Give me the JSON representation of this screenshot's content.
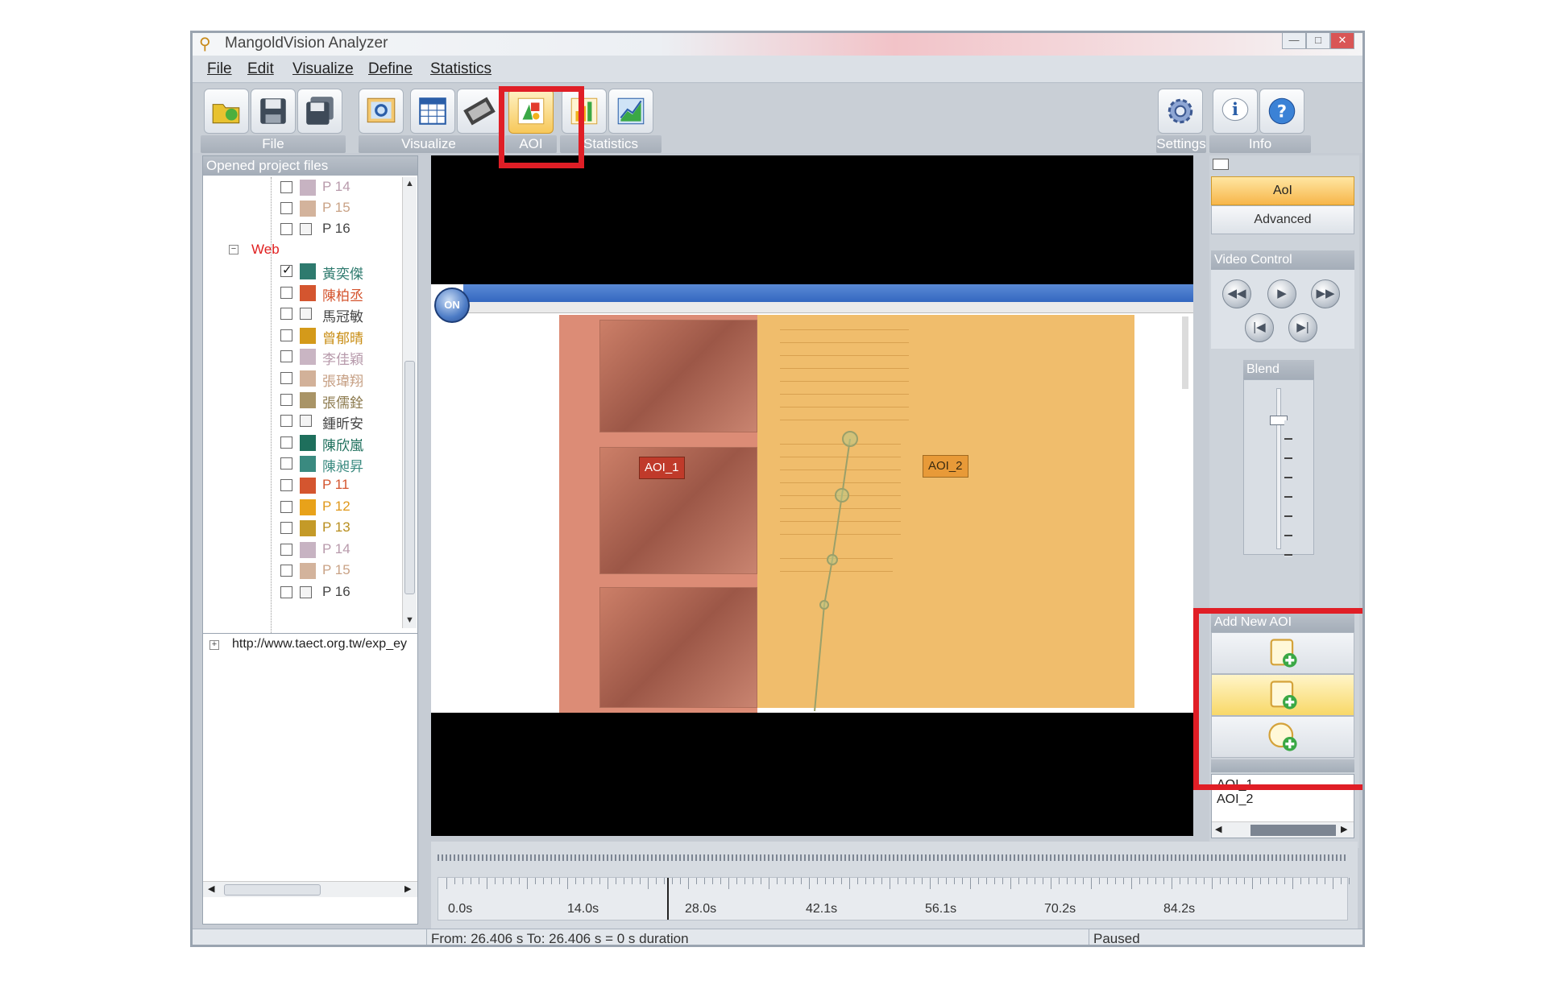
{
  "window": {
    "title": "MangoldVision Analyzer"
  },
  "menu": [
    "File",
    "Edit",
    "Visualize",
    "Define",
    "Statistics"
  ],
  "ribbon": {
    "groups": {
      "file": "File",
      "visualize": "Visualize",
      "aoi": "AOI",
      "statistics": "Statistics",
      "settings": "Settings",
      "info": "Info"
    },
    "buttons": [
      {
        "name": "open-project-icon"
      },
      {
        "name": "save-icon"
      },
      {
        "name": "save-all-icon"
      },
      {
        "name": "preview-icon"
      },
      {
        "name": "grid-view-icon"
      },
      {
        "name": "film-icon"
      },
      {
        "name": "aoi-icon"
      },
      {
        "name": "bar-chart-icon"
      },
      {
        "name": "line-chart-icon"
      },
      {
        "name": "gear-icon"
      },
      {
        "name": "info-icon"
      },
      {
        "name": "help-icon"
      }
    ]
  },
  "project_pane": {
    "header": "Opened project files",
    "group_label": "Web",
    "items_top": [
      {
        "label": "P 14",
        "color": "#c7b3c2",
        "checked": false,
        "text_color": "#b89aab"
      },
      {
        "label": "P 15",
        "color": "#d3b39c",
        "checked": false,
        "text_color": "#c9a286"
      },
      {
        "label": "P 16",
        "color": "",
        "checked": false,
        "text_color": "#444444"
      }
    ],
    "items": [
      {
        "label": "黃奕傑",
        "color": "#2e7a6e",
        "checked": true,
        "text_color": "#2e7a6e"
      },
      {
        "label": "陳柏丞",
        "color": "#d4552f",
        "checked": false,
        "text_color": "#d4552f"
      },
      {
        "label": "馬冠敏",
        "color": "",
        "checked": false,
        "text_color": "#444444"
      },
      {
        "label": "曾郁晴",
        "color": "#d49a1a",
        "checked": false,
        "text_color": "#c88c12"
      },
      {
        "label": "李佳穎",
        "color": "#c9b5c3",
        "checked": false,
        "text_color": "#b79aab"
      },
      {
        "label": "張瑋翔",
        "color": "#d2b199",
        "checked": false,
        "text_color": "#c59e82"
      },
      {
        "label": "張儒銓",
        "color": "#a99466",
        "checked": false,
        "text_color": "#8c7a4e"
      },
      {
        "label": "鍾昕安",
        "color": "",
        "checked": false,
        "text_color": "#444444"
      },
      {
        "label": "陳欣嵐",
        "color": "#1e6f5c",
        "checked": false,
        "text_color": "#1e6f5c"
      },
      {
        "label": "陳昶昇",
        "color": "#3a8a80",
        "checked": false,
        "text_color": "#3a8a80"
      },
      {
        "label": "P 11",
        "color": "#d4552f",
        "checked": false,
        "text_color": "#d4552f"
      },
      {
        "label": "P 12",
        "color": "#e8a21a",
        "checked": false,
        "text_color": "#e0981a"
      },
      {
        "label": "P 13",
        "color": "#c49a28",
        "checked": false,
        "text_color": "#b88e1e"
      },
      {
        "label": "P 14",
        "color": "#c7b3c2",
        "checked": false,
        "text_color": "#b89aab"
      },
      {
        "label": "P 15",
        "color": "#d3b39c",
        "checked": false,
        "text_color": "#c9a286"
      },
      {
        "label": "P 16",
        "color": "",
        "checked": false,
        "text_color": "#444444"
      }
    ],
    "url": "http://www.taect.org.tw/exp_ey"
  },
  "video": {
    "aoi1_label": "AOI_1",
    "aoi2_label": "AOI_2",
    "viewer_icon": "ON"
  },
  "right_panel": {
    "tab_aoi": "AoI",
    "tab_advanced": "Advanced",
    "video_control_header": "Video Control",
    "blend_header": "Blend",
    "add_new_aoi_header": "Add New AOI",
    "aoi_list": [
      "AOI_1",
      "AOI_2"
    ]
  },
  "timeline": {
    "labels": [
      "0.0s",
      "14.0s",
      "28.0s",
      "42.1s",
      "56.1s",
      "70.2s",
      "84.2s"
    ]
  },
  "status": {
    "range": "From: 26.406 s   To: 26.406 s   =   0 s duration",
    "state": "Paused"
  },
  "colors": {
    "highlight": "#e01e26",
    "aoi1": "#dc8c76",
    "aoi2": "#f0bd6c"
  }
}
